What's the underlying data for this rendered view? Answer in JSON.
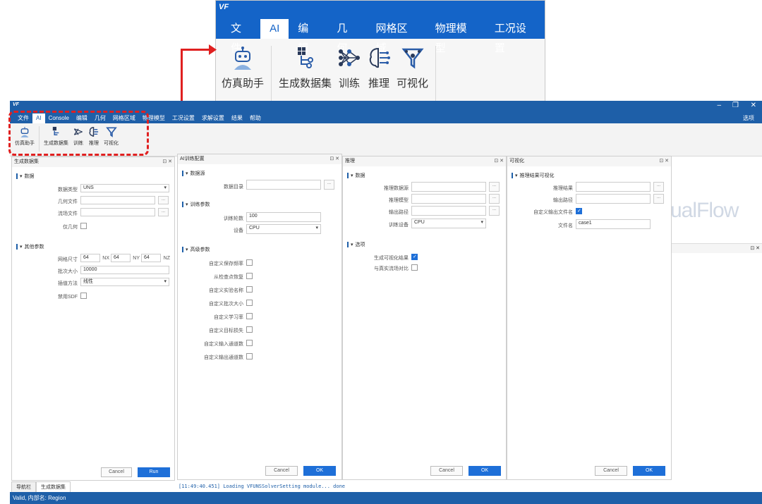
{
  "zoom": {
    "logo": "VF",
    "menu": [
      "文件",
      "AI",
      "编辑",
      "几何",
      "网格区域",
      "物理模型",
      "工况设置"
    ],
    "buttons": [
      "仿真助手",
      "生成数据集",
      "训练",
      "推理",
      "可视化"
    ]
  },
  "window": {
    "logo": "VF",
    "menu": [
      "文件",
      "AI",
      "Console",
      "编辑",
      "几何",
      "网格区域",
      "物理模型",
      "工况设置",
      "求解设置",
      "结果",
      "帮助"
    ],
    "options": "选项",
    "controls": {
      "min": "–",
      "restore": "❐",
      "close": "✕"
    },
    "buttons": [
      "仿真助手",
      "生成数据集",
      "训练",
      "推理",
      "可视化"
    ]
  },
  "brand": "ualFlow",
  "p1": {
    "title": "生成数据集",
    "sec1": "数据",
    "f_type": "数据类型",
    "v_type": "UNS",
    "f_geo": "几何文件",
    "f_flow": "流场文件",
    "f_onlygeo": "仅几何",
    "sec2": "其他参数",
    "f_grid": "网格尺寸",
    "grid": [
      "64",
      "64",
      "64"
    ],
    "axes": [
      "NX",
      "NY",
      "NZ"
    ],
    "f_batch": "批次大小",
    "v_batch": "10000",
    "f_interp": "插值方法",
    "v_interp": "线性",
    "f_sdf": "禁用SDF",
    "cancel": "Cancel",
    "run": "Run"
  },
  "p2": {
    "title": "AI训练配置",
    "sec1": "数据源",
    "f_dir": "数据目录",
    "sec2": "训练参数",
    "f_epochs": "训练轮数",
    "v_epochs": "100",
    "f_dev": "设备",
    "v_dev": "CPU",
    "sec3": "高级参数",
    "adv": [
      "自定义保存频率",
      "从检查点恢复",
      "自定义实验名称",
      "自定义批次大小",
      "自定义学习率",
      "自定义目标损失",
      "自定义输入通道数",
      "自定义输出通道数"
    ],
    "cancel": "Cancel",
    "ok": "OK"
  },
  "p3": {
    "title": "推理",
    "sec1": "数据",
    "f_src": "推理数据源",
    "f_model": "推理模型",
    "f_out": "输出路径",
    "f_dev": "训练设备",
    "v_dev": "CPU",
    "sec2": "选项",
    "f_gen": "生成可视化结果",
    "f_cmp": "与真实流场对比",
    "cancel": "Cancel",
    "ok": "OK"
  },
  "p4": {
    "title": "可视化",
    "sec1": "推理结果可视化",
    "f_res": "推理结果",
    "f_out": "输出路径",
    "f_custom": "自定义输出文件名",
    "f_name": "文件名",
    "v_name": "case1",
    "cancel": "Cancel",
    "ok": "OK"
  },
  "tabs": [
    "导航栏",
    "生成数据集"
  ],
  "console": "[11:49:40.451] Loading VFUNSSolverSetting module... done",
  "statusbar": "Valid, 内部名: Region"
}
